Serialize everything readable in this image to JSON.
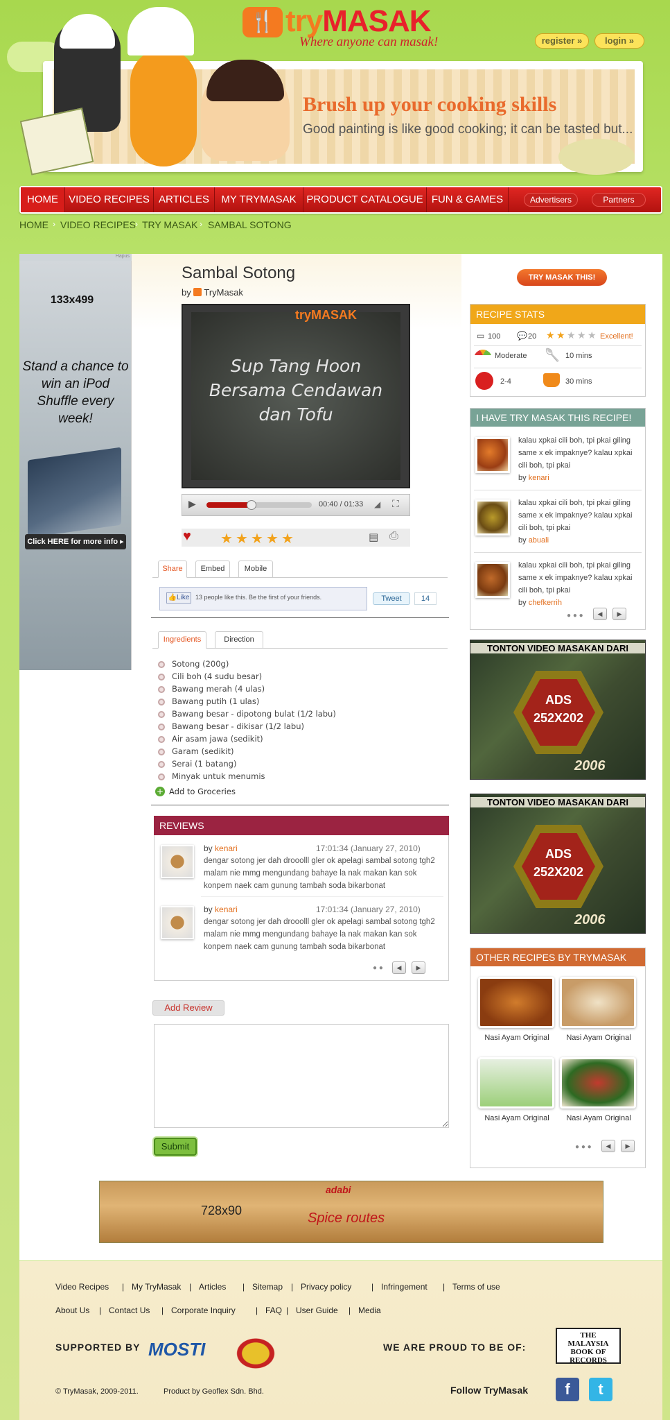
{
  "brand": {
    "name_a": "try",
    "name_b": "MASAK",
    "tagline": "Where anyone can masak!"
  },
  "header": {
    "register": "register »",
    "login": "login »"
  },
  "banner": {
    "title": "Brush up your cooking skills",
    "subtitle": "Good painting is like good cooking; it can be tasted but..."
  },
  "nav": {
    "items": [
      "HOME",
      "VIDEO RECIPES",
      "ARTICLES",
      "MY TRYMASAK",
      "PRODUCT CATALOGUE",
      "FUN & GAMES"
    ],
    "pills": [
      "Advertisers",
      "Partners"
    ]
  },
  "breadcrumb": [
    "HOME",
    "VIDEO RECIPES",
    "TRY MASAK",
    "SAMBAL SOTONG"
  ],
  "left_ad": {
    "tag": "Hapus",
    "size": "133x499",
    "copy": "Stand a chance to win an iPod Shuffle every week!",
    "cta": "Click HERE for more info ▸"
  },
  "recipe": {
    "title": "Sambal Sotong",
    "by_label": "by",
    "author": "TryMasak",
    "video_logo": "tryMASAK",
    "video_caption": "Sup Tang Hoon Bersama Cendawan dan Tofu",
    "video_time": "00:40 / 01:33",
    "video_progress": 0.43,
    "rating": 5
  },
  "share_tabs": [
    "Share",
    "Embed",
    "Mobile"
  ],
  "share": {
    "like": "👍Like",
    "like_text": "13 people like this. Be the first of your friends.",
    "tweet": "Tweet",
    "tweet_count": "14"
  },
  "ingredient_tabs": [
    "Ingredients",
    "Direction"
  ],
  "ingredients": [
    "Sotong (200g)",
    "Cili boh (4 sudu besar)",
    "Bawang merah (4 ulas)",
    "Bawang putih (1 ulas)",
    "Bawang besar - dipotong bulat (1/2 labu)",
    "Bawang besar - dikisar (1/2 labu)",
    "Air asam jawa (sedikit)",
    "Garam (sedikit)",
    "Serai (1 batang)",
    "Minyak untuk menumis"
  ],
  "add_groceries": "Add to Groceries",
  "reviews": {
    "title": "REVIEWS",
    "items": [
      {
        "by": "by",
        "name": "kenari",
        "date": "17:01:34 (January 27, 2010)",
        "text": "dengar sotong jer dah drooolll gler ok apelagi sambal sotong tgh2 malam nie mmg mengundang bahaye la nak makan kan sok konpem naek cam gunung tambah soda bikarbonat"
      },
      {
        "by": "by",
        "name": "kenari",
        "date": "17:01:34 (January 27, 2010)",
        "text": "dengar sotong jer dah drooolll gler ok apelagi sambal sotong tgh2 malam nie mmg mengundang bahaye la nak makan kan sok konpem naek cam gunung tambah soda bikarbonat"
      }
    ]
  },
  "add_review": "Add Review",
  "submit": "Submit",
  "try_btn": "TRY MASAK THIS!",
  "stats": {
    "title": "RECIPE STATS",
    "views": "100",
    "comments": "20",
    "stars": 2,
    "rating_label": "Excellent!",
    "difficulty": "Moderate",
    "prep": "10 mins",
    "serves": "2-4",
    "cook": "30 mins"
  },
  "ihave": {
    "title": "I HAVE TRY MASAK THIS RECIPE!",
    "items": [
      {
        "text": "kalau xpkai cili boh, tpi pkai giling same x ek impaknye? kalau xpkai cili boh, tpi pkai",
        "by": "by",
        "name": "kenari"
      },
      {
        "text": "kalau xpkai cili boh, tpi pkai giling same x ek impaknye? kalau xpkai cili boh, tpi pkai",
        "by": "by",
        "name": "abuali"
      },
      {
        "text": "kalau xpkai cili boh, tpi pkai giling same x ek impaknye? kalau xpkai cili boh, tpi pkai",
        "by": "by",
        "name": "chefkerrih"
      }
    ]
  },
  "right_ads": [
    {
      "top": "TONTON VIDEO MASAKAN DARI",
      "a": "ADS",
      "b": "252X202",
      "year": "2006"
    },
    {
      "top": "TONTON VIDEO MASAKAN DARI",
      "a": "ADS",
      "b": "252X202",
      "year": "2006"
    }
  ],
  "other": {
    "title": "OTHER RECIPES BY TRYMASAK",
    "items": [
      "Nasi Ayam Original",
      "Nasi Ayam Original",
      "Nasi Ayam Original",
      "Nasi Ayam Original"
    ]
  },
  "bottom_ad": {
    "size": "728x90",
    "brand": "adabi",
    "title": "Spice routes"
  },
  "footer": {
    "row1": [
      "Video Recipes",
      "My TryMasak",
      "Articles",
      "Sitemap",
      "Privacy policy",
      "Infringement",
      "Terms of use"
    ],
    "row2": [
      "About Us",
      "Contact Us",
      "Corporate Inquiry",
      "FAQ",
      "User Guide",
      "Media"
    ],
    "supported": "SUPPORTED BY",
    "mosti": "MOSTI",
    "proud": "WE ARE PROUD TO BE OF:",
    "mbr": "THE MALAYSIA BOOK OF RECORDS",
    "copyright": "© TryMasak, 2009-2011.",
    "product": "Product by Geoflex Sdn. Bhd.",
    "follow": "Follow TryMasak"
  },
  "colors": {
    "accent": "#f47a20",
    "nav": "#c8181a",
    "reviews": "#9b2341",
    "stats": "#f0a719",
    "ihave": "#78a396",
    "other": "#d16a32"
  }
}
